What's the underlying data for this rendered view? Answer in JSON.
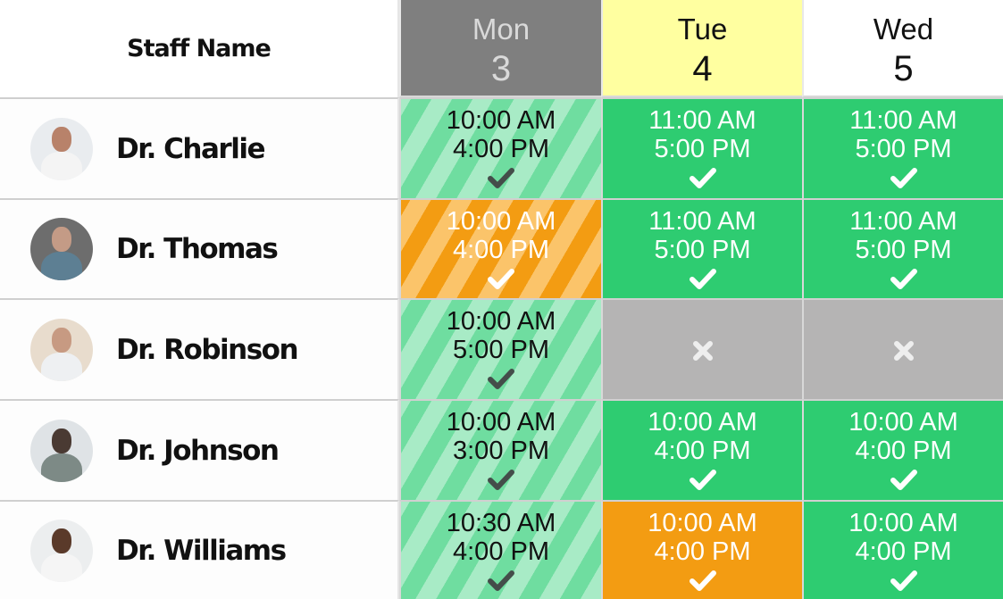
{
  "header": {
    "staff_column_label": "Staff Name",
    "days": [
      {
        "name": "Mon",
        "date": "3",
        "state": "past"
      },
      {
        "name": "Tue",
        "date": "4",
        "state": "today"
      },
      {
        "name": "Wed",
        "date": "5",
        "state": "future"
      }
    ]
  },
  "colors": {
    "scheduled": "#2ecc71",
    "warning": "#f39c12",
    "off": "#b5b4b4",
    "today_header": "#ffffa0",
    "past_header": "#7f7f7f"
  },
  "staff": [
    {
      "name": "Dr. Charlie",
      "avatar": "doctor-photo",
      "shifts": [
        {
          "start": "10:00 AM",
          "end": "4:00 PM",
          "status": "past-scheduled",
          "icon": "check-icon"
        },
        {
          "start": "11:00 AM",
          "end": "5:00 PM",
          "status": "scheduled",
          "icon": "check-icon"
        },
        {
          "start": "11:00 AM",
          "end": "5:00 PM",
          "status": "scheduled",
          "icon": "check-icon"
        }
      ]
    },
    {
      "name": "Dr. Thomas",
      "avatar": "doctor-photo",
      "shifts": [
        {
          "start": "10:00 AM",
          "end": "4:00 PM",
          "status": "past-warning",
          "icon": "check-icon"
        },
        {
          "start": "11:00 AM",
          "end": "5:00 PM",
          "status": "scheduled",
          "icon": "check-icon"
        },
        {
          "start": "11:00 AM",
          "end": "5:00 PM",
          "status": "scheduled",
          "icon": "check-icon"
        }
      ]
    },
    {
      "name": "Dr. Robinson",
      "avatar": "doctor-photo",
      "shifts": [
        {
          "start": "10:00 AM",
          "end": "5:00 PM",
          "status": "past-scheduled",
          "icon": "check-icon"
        },
        {
          "start": "",
          "end": "",
          "status": "off",
          "icon": "x-icon"
        },
        {
          "start": "",
          "end": "",
          "status": "off",
          "icon": "x-icon"
        }
      ]
    },
    {
      "name": "Dr. Johnson",
      "avatar": "doctor-photo",
      "shifts": [
        {
          "start": "10:00 AM",
          "end": "3:00 PM",
          "status": "past-scheduled",
          "icon": "check-icon"
        },
        {
          "start": "10:00 AM",
          "end": "4:00 PM",
          "status": "scheduled",
          "icon": "check-icon"
        },
        {
          "start": "10:00 AM",
          "end": "4:00 PM",
          "status": "scheduled",
          "icon": "check-icon"
        }
      ]
    },
    {
      "name": "Dr. Williams",
      "avatar": "doctor-photo",
      "shifts": [
        {
          "start": "10:30 AM",
          "end": "4:00 PM",
          "status": "past-scheduled",
          "icon": "check-icon"
        },
        {
          "start": "10:00 AM",
          "end": "4:00 PM",
          "status": "warning",
          "icon": "check-icon"
        },
        {
          "start": "10:00 AM",
          "end": "4:00 PM",
          "status": "scheduled",
          "icon": "check-icon"
        }
      ]
    }
  ]
}
